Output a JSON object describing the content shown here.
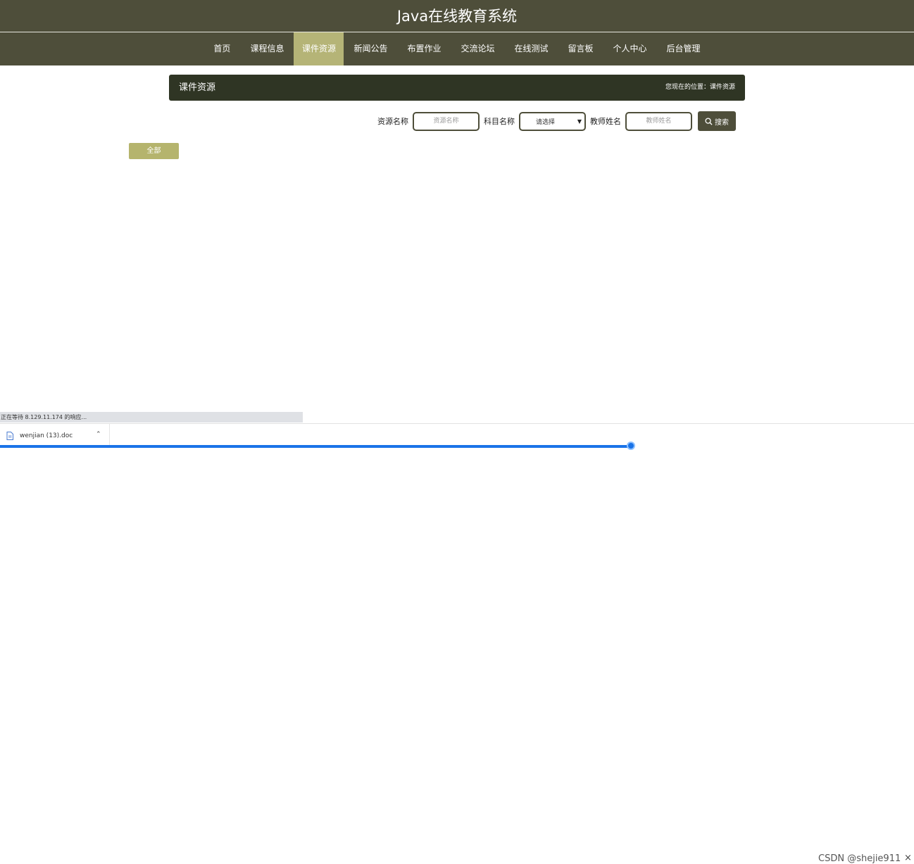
{
  "header": {
    "site_title": "Java在线教育系统"
  },
  "nav": {
    "items": [
      {
        "label": "首页"
      },
      {
        "label": "课程信息"
      },
      {
        "label": "课件资源"
      },
      {
        "label": "新闻公告"
      },
      {
        "label": "布置作业"
      },
      {
        "label": "交流论坛"
      },
      {
        "label": "在线测试"
      },
      {
        "label": "留言板"
      },
      {
        "label": "个人中心"
      },
      {
        "label": "后台管理"
      }
    ],
    "active_index": 2
  },
  "panel": {
    "title": "课件资源",
    "breadcrumb": "您现在的位置：课件资源"
  },
  "search": {
    "resource_label": "资源名称",
    "resource_placeholder": "资源名称",
    "subject_label": "科目名称",
    "subject_selected": "请选择",
    "teacher_label": "教师姓名",
    "teacher_placeholder": "教师姓名",
    "button_label": "搜索"
  },
  "filter": {
    "all_label": "全部"
  },
  "browser": {
    "status_text": "正在等待 8.129.11.174 的响应...",
    "download_name": "wenjian (13).doc",
    "watermark": "CSDN @shejie911"
  },
  "colors": {
    "header_bg": "#4e4e3a",
    "active_nav": "#b5b477",
    "panel_bg": "#2f3524",
    "all_button": "#b5b46d"
  }
}
